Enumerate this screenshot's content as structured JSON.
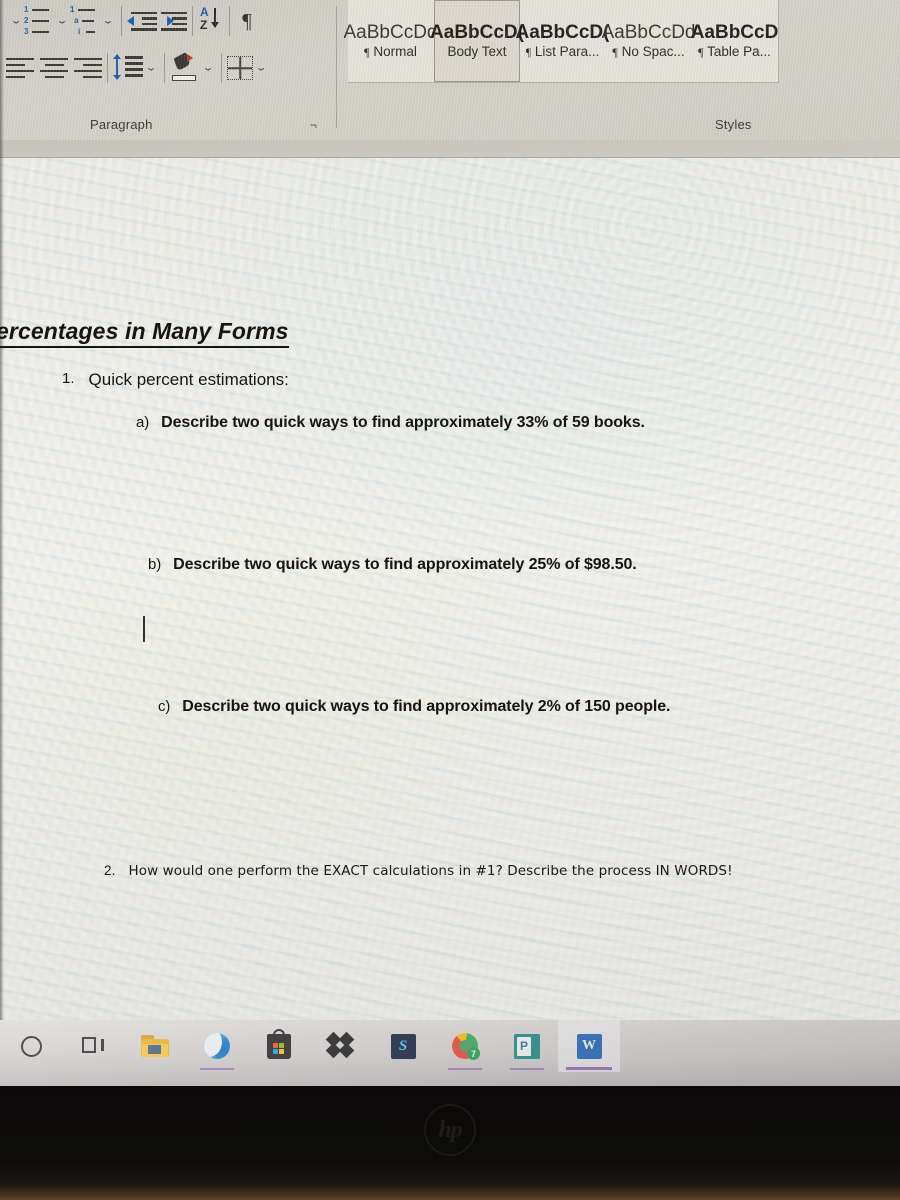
{
  "application": {
    "name": "Microsoft Word",
    "window_type": "photo-of-screen"
  },
  "ribbon": {
    "paragraph_group": {
      "label": "Paragraph",
      "dialog_launcher": "⌐",
      "row1": [
        {
          "name": "numbered-list",
          "icon": "numbered-list-icon",
          "has_dropdown": true
        },
        {
          "name": "multilevel-list",
          "icon": "multilevel-list-icon",
          "has_dropdown": true
        },
        {
          "name": "decrease-indent",
          "icon": "decrease-indent-icon"
        },
        {
          "name": "increase-indent",
          "icon": "increase-indent-icon"
        },
        {
          "name": "sort",
          "icon": "sort-az-icon",
          "label": "A Z"
        },
        {
          "name": "show-formatting-marks",
          "icon": "pilcrow-icon",
          "glyph": "¶"
        }
      ],
      "row2": [
        {
          "name": "align-left",
          "icon": "align-left-icon"
        },
        {
          "name": "align-center",
          "icon": "align-center-icon"
        },
        {
          "name": "align-right",
          "icon": "align-right-icon"
        },
        {
          "name": "line-spacing",
          "icon": "line-spacing-icon",
          "has_dropdown": true
        },
        {
          "name": "shading",
          "icon": "paint-bucket-icon",
          "has_dropdown": true
        },
        {
          "name": "borders",
          "icon": "borders-grid-icon",
          "has_dropdown": true
        }
      ]
    },
    "styles_group": {
      "label": "Styles",
      "items": [
        {
          "preview": "AaBbCcDd",
          "name": "Normal",
          "pilcrow": "¶",
          "selected": false,
          "weight": "light"
        },
        {
          "preview": "AaBbCcD(",
          "name": "Body Text",
          "pilcrow": "",
          "selected": true,
          "weight": "bold"
        },
        {
          "preview": "AaBbCcD(",
          "name": "List Para...",
          "pilcrow": "¶",
          "selected": false,
          "weight": "bold"
        },
        {
          "preview": "AaBbCcDd",
          "name": "No Spac...",
          "pilcrow": "¶",
          "selected": false,
          "weight": "light"
        },
        {
          "preview": "AaBbCcD",
          "name": "Table Pa...",
          "pilcrow": "¶",
          "selected": false,
          "weight": "bold"
        }
      ]
    }
  },
  "document": {
    "heading": "ercentages in Many Forms",
    "heading_note": "left edge cut off — full text likely 'Percentages in Many Forms'",
    "item1": {
      "marker": "1.",
      "text": "Quick percent estimations:"
    },
    "subitems": [
      {
        "marker": "a)",
        "text": "Describe two quick ways to find approximately 33% of 59 books."
      },
      {
        "marker": "b)",
        "text": "Describe two quick ways to find approximately 25% of $98.50."
      },
      {
        "marker": "c)",
        "text": "Describe two quick ways to find approximately 2% of 150 people."
      }
    ],
    "item2": {
      "marker": "2.",
      "text": "How would one perform the EXACT calculations in #1? Describe the process IN WORDS!"
    },
    "cursor_present": true
  },
  "taskbar": {
    "items": [
      {
        "name": "cortana",
        "icon": "circle-icon",
        "label": "Cortana"
      },
      {
        "name": "task-view",
        "icon": "task-view-icon",
        "label": "Task View"
      },
      {
        "name": "file-explorer",
        "icon": "folder-icon",
        "label": "File Explorer"
      },
      {
        "name": "edge",
        "icon": "edge-icon",
        "label": "Microsoft Edge"
      },
      {
        "name": "microsoft-store",
        "icon": "shopping-bag-icon",
        "label": "Microsoft Store"
      },
      {
        "name": "dropbox",
        "icon": "dropbox-icon",
        "label": "Dropbox"
      },
      {
        "name": "terminal-app",
        "icon": "dark-app-icon",
        "label": "S"
      },
      {
        "name": "chrome",
        "icon": "chrome-icon",
        "label": "Google Chrome",
        "badge": "7"
      },
      {
        "name": "powerpoint",
        "icon": "powerpoint-icon",
        "label": "P"
      },
      {
        "name": "word",
        "icon": "word-icon",
        "label": "W",
        "active": true
      }
    ]
  },
  "bezel": {
    "brand": "hp"
  },
  "colors": {
    "ribbon_bg": "#d2cfc7",
    "accent_blue": "#1f5fa9",
    "page_bg": "#f0eeea",
    "text": "#17150f",
    "taskbar_bg": "#cfccca",
    "bezel": "#0b0a09",
    "word_blue": "#1d64b8",
    "active_underline": "#7b3fa0"
  }
}
